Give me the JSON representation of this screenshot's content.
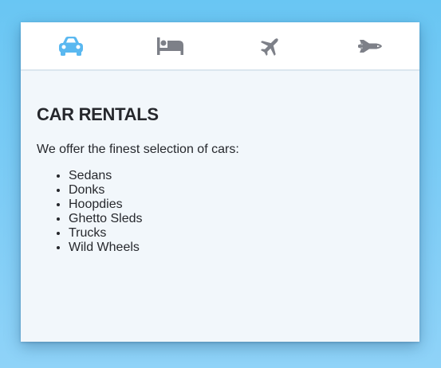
{
  "tabs": [
    {
      "icon": "car-icon",
      "active": true
    },
    {
      "icon": "bed-icon",
      "active": false
    },
    {
      "icon": "plane-icon",
      "active": false
    },
    {
      "icon": "space-shuttle-icon",
      "active": false
    }
  ],
  "colors": {
    "active_icon": "#5ab8f0",
    "inactive_icon": "#7d8088",
    "text": "#26282d",
    "panel_bg": "#f2f7fb",
    "tabbar_bg": "#ffffff"
  },
  "panel": {
    "title": "CAR RENTALS",
    "intro": "We offer the finest selection of cars:",
    "items": [
      "Sedans",
      "Donks",
      "Hoopdies",
      "Ghetto Sleds",
      "Trucks",
      "Wild Wheels"
    ]
  }
}
